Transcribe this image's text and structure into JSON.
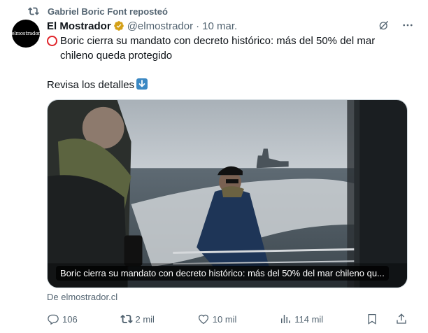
{
  "repost": {
    "text": "Gabriel Boric Font reposteó"
  },
  "author": {
    "avatar_text": "elmostrador",
    "name": "El Mostrador",
    "handle": "@elmostrador",
    "separator": "·",
    "date": "10 mar.",
    "verified_color": "#d4a017"
  },
  "tweet": {
    "line1": "Boric cierra su mandato con decreto histórico: más del 50% del mar chileno queda protegido",
    "line2": "Revisa los detalles"
  },
  "media": {
    "caption": "Boric cierra su mandato con decreto histórico: más del 50% del mar chileno qu..."
  },
  "source": {
    "text": "De elmostrador.cl"
  },
  "actions": {
    "replies": "106",
    "reposts": "2 mil",
    "likes": "10 mil",
    "views": "114 mil"
  },
  "colors": {
    "muted": "#536471",
    "repost_active": "#536471",
    "accent": "#1d9bf0"
  },
  "icons": [
    "repost-icon",
    "verified-icon",
    "grok-icon",
    "more-icon",
    "reply-icon",
    "retweet-icon",
    "like-icon",
    "views-icon",
    "bookmark-icon",
    "share-icon"
  ]
}
